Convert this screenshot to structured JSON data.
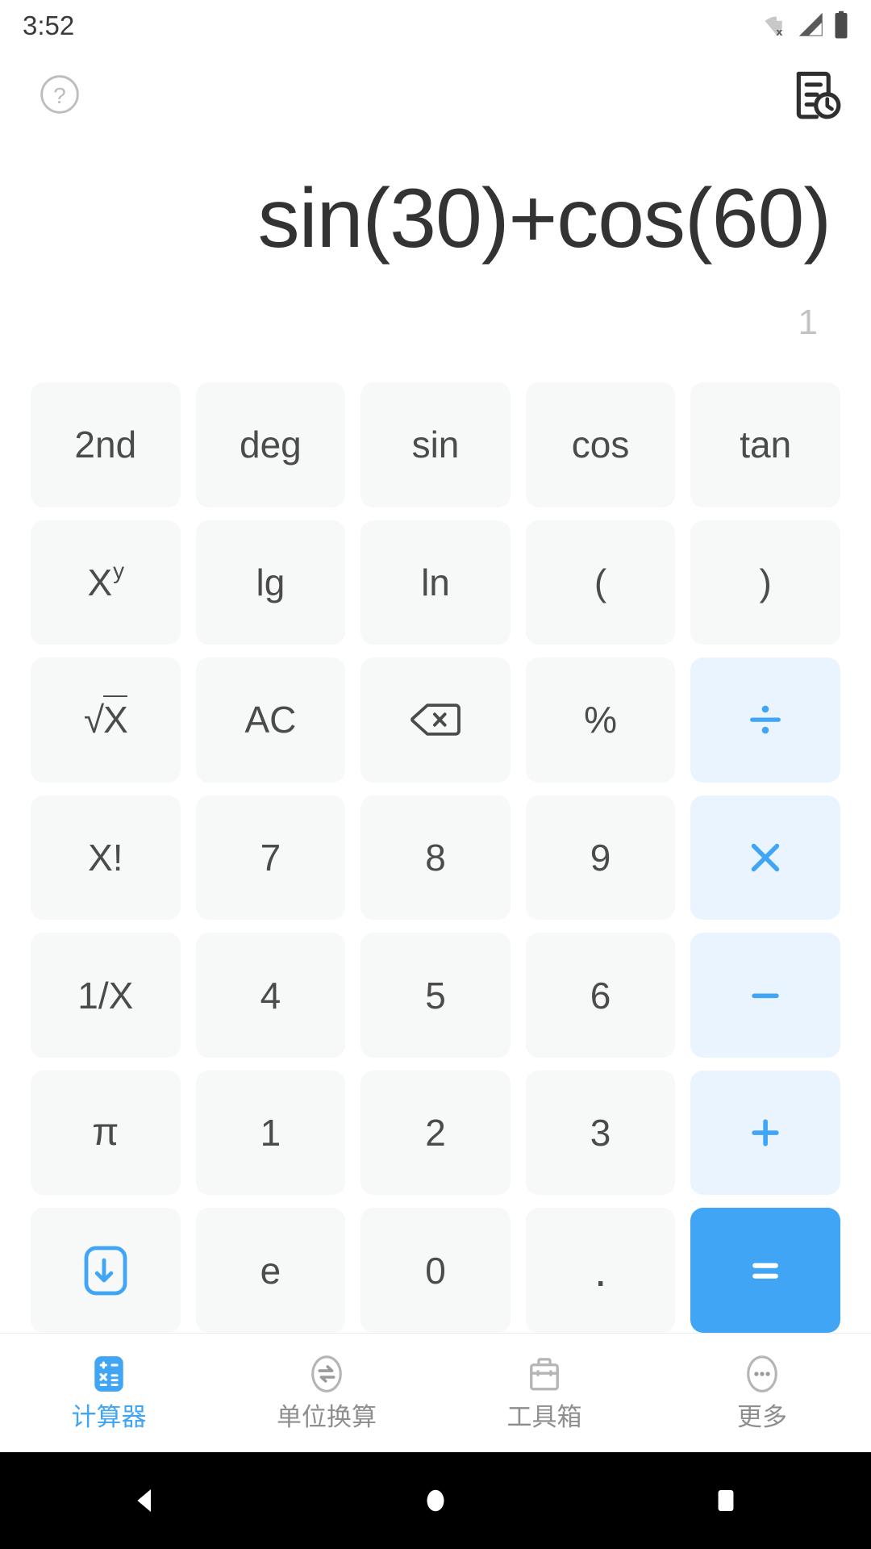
{
  "status_bar": {
    "time": "3:52",
    "icons": [
      "wifi-off-icon",
      "signal-icon",
      "battery-icon"
    ]
  },
  "action_bar": {
    "help_icon": "help-circle-icon",
    "history_icon": "history-icon"
  },
  "display": {
    "expression": "sin(30)+cos(60)",
    "result": "1"
  },
  "colors": {
    "accent": "#41a5f5",
    "operator_bg": "#eaf4fe",
    "key_bg": "#f7f8f8",
    "key_text": "#4b4b4b",
    "expression_text": "#333333",
    "result_text": "#c3c3c3",
    "nav_inactive": "#8e8e8e"
  },
  "keypad": {
    "rows": [
      [
        {
          "label": "2nd",
          "name": "key-2nd",
          "kind": "fn"
        },
        {
          "label": "deg",
          "name": "key-deg",
          "kind": "fn"
        },
        {
          "label": "sin",
          "name": "key-sin",
          "kind": "fn"
        },
        {
          "label": "cos",
          "name": "key-cos",
          "kind": "fn"
        },
        {
          "label": "tan",
          "name": "key-tan",
          "kind": "fn"
        }
      ],
      [
        {
          "label": "Xy",
          "name": "key-power",
          "kind": "fn-sup",
          "base": "X",
          "sup": "y"
        },
        {
          "label": "lg",
          "name": "key-lg",
          "kind": "fn"
        },
        {
          "label": "ln",
          "name": "key-ln",
          "kind": "fn"
        },
        {
          "label": "(",
          "name": "key-open-paren",
          "kind": "fn"
        },
        {
          "label": ")",
          "name": "key-close-paren",
          "kind": "fn"
        }
      ],
      [
        {
          "label": "√X",
          "name": "key-sqrt",
          "kind": "fn"
        },
        {
          "label": "AC",
          "name": "key-ac",
          "kind": "fn"
        },
        {
          "label": "",
          "name": "key-backspace",
          "kind": "icon-backspace"
        },
        {
          "label": "%",
          "name": "key-percent",
          "kind": "fn"
        },
        {
          "label": "÷",
          "name": "key-divide",
          "kind": "op-divide"
        }
      ],
      [
        {
          "label": "X!",
          "name": "key-factorial",
          "kind": "fn"
        },
        {
          "label": "7",
          "name": "key-7",
          "kind": "digit"
        },
        {
          "label": "8",
          "name": "key-8",
          "kind": "digit"
        },
        {
          "label": "9",
          "name": "key-9",
          "kind": "digit"
        },
        {
          "label": "×",
          "name": "key-multiply",
          "kind": "op-multiply"
        }
      ],
      [
        {
          "label": "1/X",
          "name": "key-reciprocal",
          "kind": "fn"
        },
        {
          "label": "4",
          "name": "key-4",
          "kind": "digit"
        },
        {
          "label": "5",
          "name": "key-5",
          "kind": "digit"
        },
        {
          "label": "6",
          "name": "key-6",
          "kind": "digit"
        },
        {
          "label": "−",
          "name": "key-minus",
          "kind": "op-minus"
        }
      ],
      [
        {
          "label": "π",
          "name": "key-pi",
          "kind": "fn"
        },
        {
          "label": "1",
          "name": "key-1",
          "kind": "digit"
        },
        {
          "label": "2",
          "name": "key-2",
          "kind": "digit"
        },
        {
          "label": "3",
          "name": "key-3",
          "kind": "digit"
        },
        {
          "label": "+",
          "name": "key-plus",
          "kind": "op-plus"
        }
      ],
      [
        {
          "label": "",
          "name": "key-collapse-keyboard",
          "kind": "icon-collapse"
        },
        {
          "label": "e",
          "name": "key-e",
          "kind": "fn"
        },
        {
          "label": "0",
          "name": "key-0",
          "kind": "digit"
        },
        {
          "label": ".",
          "name": "key-decimal",
          "kind": "digit"
        },
        {
          "label": "=",
          "name": "key-equals",
          "kind": "equals"
        }
      ]
    ]
  },
  "bottom_nav": {
    "items": [
      {
        "label": "计算器",
        "icon": "calculator-icon",
        "active": true
      },
      {
        "label": "单位换算",
        "icon": "unit-convert-icon",
        "active": false
      },
      {
        "label": "工具箱",
        "icon": "toolbox-icon",
        "active": false
      },
      {
        "label": "更多",
        "icon": "more-dots-icon",
        "active": false
      }
    ]
  },
  "system_nav": {
    "back": "back-triangle-icon",
    "home": "home-circle-icon",
    "recents": "recents-square-icon"
  }
}
